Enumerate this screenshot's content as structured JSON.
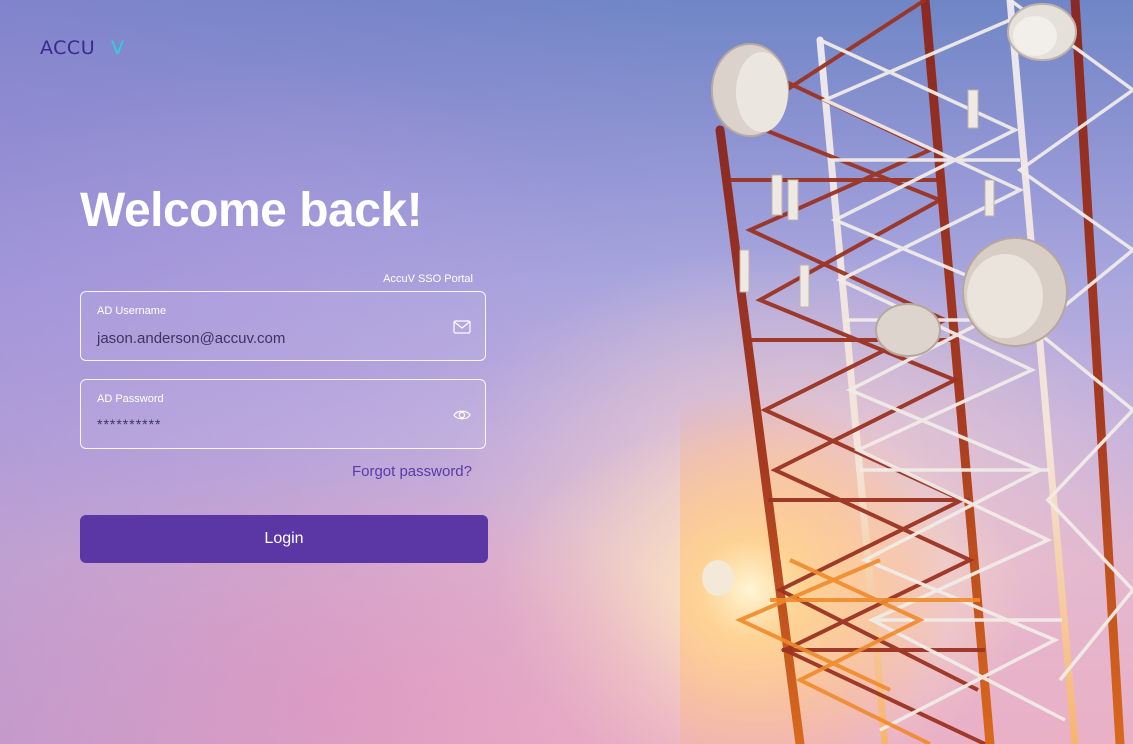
{
  "brand": {
    "logo_text_main": "ACCU",
    "logo_text_accent": "V",
    "logo_color": "#3a2a8f",
    "logo_accent_color": "#2bd3d6"
  },
  "heading": "Welcome back!",
  "portal_label": "AccuV SSO Portal",
  "form": {
    "username": {
      "label": "AD Username",
      "value": "jason.anderson@accuv.com",
      "icon": "mail-icon"
    },
    "password": {
      "label": "AD Password",
      "value": "**********",
      "icon": "eye-icon"
    },
    "forgot_link": "Forgot password?",
    "login_button": "Login"
  },
  "colors": {
    "primary": "#5a37a4",
    "link": "#5a3aa8",
    "input_text": "#3b3560"
  },
  "background": {
    "subject": "telecom-tower-sunset"
  }
}
